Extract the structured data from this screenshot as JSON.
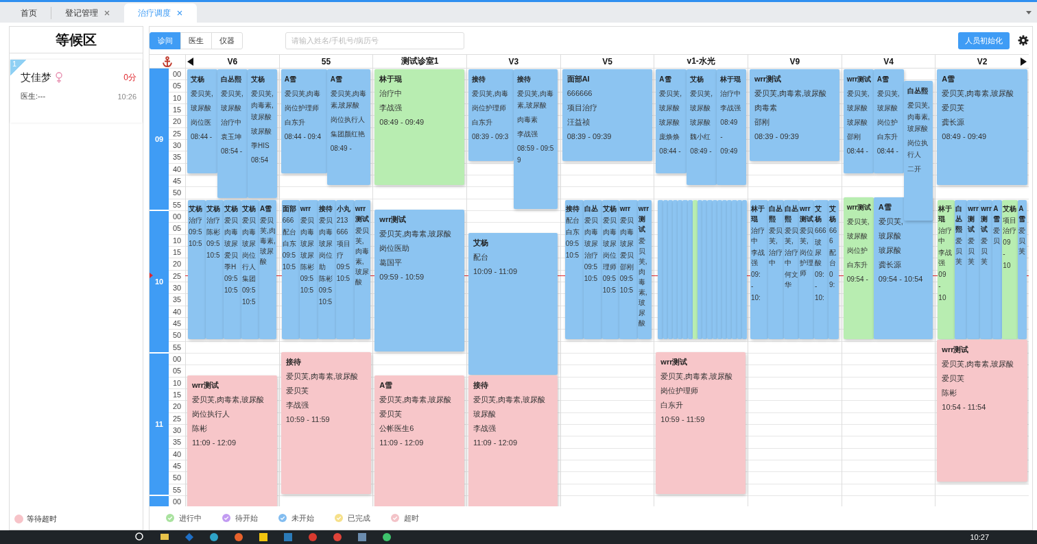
{
  "tabs": [
    {
      "label": "首页",
      "closable": false,
      "selected": false
    },
    {
      "label": "登记管理",
      "closable": true,
      "selected": false
    },
    {
      "label": "治疗调度",
      "closable": true,
      "selected": true
    }
  ],
  "waiting_area": {
    "title": "等候区",
    "patients": [
      {
        "index": "1",
        "name": "艾佳梦",
        "kind": "female",
        "score": "0分",
        "doctor": "医生:---",
        "time": "10:26"
      }
    ],
    "legend": {
      "label": "等待超时",
      "color": "#f7c3c8"
    }
  },
  "toolbar": {
    "view_tabs": [
      {
        "label": "诊间",
        "selected": true
      },
      {
        "label": "医生",
        "selected": false
      },
      {
        "label": "仪器",
        "selected": false
      }
    ],
    "search": {
      "placeholder": "请输入姓名/手机号/病历号"
    },
    "init_button": "人员初始化"
  },
  "schedule": {
    "hours": [
      {
        "label": "09",
        "minutes": [
          "00",
          "05",
          "10",
          "15",
          "20",
          "25",
          "30",
          "35",
          "40",
          "45",
          "50",
          "55"
        ]
      },
      {
        "label": "10",
        "minutes": [
          "00",
          "05",
          "10",
          "15",
          "20",
          "25",
          "30",
          "35",
          "40",
          "45",
          "50",
          "55"
        ]
      },
      {
        "label": "11",
        "minutes": [
          "00",
          "05",
          "10",
          "15",
          "20",
          "25",
          "30",
          "35",
          "40",
          "45",
          "50",
          "55"
        ]
      },
      {
        "minutes": [
          "00"
        ]
      }
    ],
    "columns": [
      {
        "name": "V6",
        "cards": [
          {
            "color": "#8cc4f1",
            "lines": [
              "艾杨",
              "爱贝芙,",
              "玻尿酸",
              "岗位医",
              "08:44 -"
            ]
          },
          {
            "color": "#8cc4f1",
            "lines": [
              "白丛熙",
              "爱贝芙,",
              "玻尿酸",
              "治疗中",
              "袁玉坤",
              "08:54 -"
            ]
          },
          {
            "color": "#8cc4f1",
            "lines": [
              "艾杨",
              "爱贝芙,肉毒素,玻尿酸",
              "玻尿酸",
              "季HIS",
              "08:54"
            ]
          },
          {
            "color": "#8cc4f1",
            "lines": [
              "艾杨",
              "治疗",
              "09:5",
              "10:5"
            ]
          },
          {
            "color": "#8cc4f1",
            "lines": [
              "艾杨",
              "治疗",
              "陈彬",
              "09:5",
              "10:5"
            ]
          },
          {
            "color": "#8cc4f1",
            "lines": [
              "艾杨",
              "爱贝",
              "肉毒",
              "玻尿",
              "爱贝",
              "季H",
              "09:5",
              "10:5"
            ]
          },
          {
            "color": "#8cc4f1",
            "lines": [
              "艾杨",
              "爱贝",
              "肉毒",
              "玻尿",
              "岗位",
              "行人",
              "集团",
              "09:5",
              "10:5"
            ]
          },
          {
            "color": "#8cc4f1",
            "lines": [
              "A雪",
              "爱贝芙,肉毒素,玻尿酸"
            ]
          },
          {
            "color": "#f7c6c9",
            "lines": [
              "wrr测试",
              "爱贝芙,肉毒素,玻尿酸",
              "岗位执行人",
              "陈彬",
              "11:09 - 12:09"
            ]
          }
        ]
      },
      {
        "name": "55",
        "cards": [
          {
            "color": "#8cc4f1",
            "lines": [
              "A雪",
              "爱贝芙,肉毒",
              "岗位护理师",
              "白东升",
              "08:44 - 09:4"
            ]
          },
          {
            "color": "#8cc4f1",
            "lines": [
              "A雪",
              "爱贝芙,肉毒素,玻尿酸",
              "岗位执行人",
              "集团颜红艳",
              "08:49 -"
            ]
          },
          {
            "color": "#8cc4f1",
            "lines": [
              "面部",
              "666",
              "配台",
              "白东",
              "09:5",
              "10:5"
            ]
          },
          {
            "color": "#8cc4f1",
            "lines": [
              "wrr",
              "爱贝",
              "肉毒",
              "玻尿",
              "玻尿",
              "陈彬",
              "09:5",
              "10:5"
            ]
          },
          {
            "color": "#8cc4f1",
            "lines": [
              "接待",
              "爱贝",
              "肉毒",
              "玻尿",
              "岗位",
              "助",
              "陈彬",
              "09:5",
              "10:5"
            ]
          },
          {
            "color": "#8cc4f1",
            "lines": [
              "小丸",
              "213",
              "666",
              "项目",
              "疗",
              "09:5",
              "10:5"
            ]
          },
          {
            "color": "#8cc4f1",
            "lines": [
              "wrr测试",
              "爱贝芙,肉毒素,玻尿酸"
            ]
          },
          {
            "color": "#f7c6c9",
            "lines": [
              "接待",
              "爱贝芙,肉毒素,玻尿酸",
              "爱贝芙",
              "李战强",
              "10:59 - 11:59"
            ]
          }
        ]
      },
      {
        "name": "测试诊室1",
        "cards": [
          {
            "color": "#b8edb1",
            "lines": [
              "林于琨",
              "治疗中",
              "李战强",
              "08:49 - 09:49"
            ]
          },
          {
            "color": "#8cc4f1",
            "lines": [
              "wrr测试",
              "爱贝芙,肉毒素,玻尿酸",
              "岗位医助",
              "葛国平",
              "09:59 - 10:59"
            ]
          },
          {
            "color": "#f7c6c9",
            "lines": [
              "A雪",
              "爱贝芙,肉毒素,玻尿酸",
              "爱贝芙",
              "公帐医生6",
              "11:09 - 12:09"
            ]
          }
        ]
      },
      {
        "name": "V3",
        "cards": [
          {
            "color": "#8cc4f1",
            "lines": [
              "接待",
              "爱贝芙,肉毒",
              "岗位护理师",
              "白东升",
              "08:39 - 09:3"
            ]
          },
          {
            "color": "#8cc4f1",
            "lines": [
              "接待",
              "爱贝芙,肉毒素,玻尿酸",
              "肉毒素",
              "李战强",
              "08:59 - 09:59"
            ]
          },
          {
            "color": "#8cc4f1",
            "lines": [
              "艾杨",
              "配台",
              "10:09 - 11:09"
            ]
          },
          {
            "color": "#f7c6c9",
            "lines": [
              "接待",
              "爱贝芙,肉毒素,玻尿酸",
              "玻尿酸",
              "李战强",
              "11:09 - 12:09"
            ]
          }
        ]
      },
      {
        "name": "V5",
        "cards": [
          {
            "color": "#8cc4f1",
            "lines": [
              "面部AI",
              "666666",
              "项目治疗",
              "汪益祯",
              "08:39 - 09:39"
            ]
          },
          {
            "color": "#8cc4f1",
            "lines": [
              "接待",
              "配台",
              "白东",
              "09:5",
              "10:5"
            ]
          },
          {
            "color": "#8cc4f1",
            "lines": [
              "白丛",
              "爱贝",
              "肉毒",
              "玻尿",
              "治疗",
              "09:5",
              "10:5"
            ]
          },
          {
            "color": "#8cc4f1",
            "lines": [
              "艾杨",
              "爱贝",
              "肉毒",
              "玻尿",
              "岗位",
              "理师",
              "09:5",
              "10:5"
            ]
          },
          {
            "color": "#8cc4f1",
            "lines": [
              "wrr",
              "爱贝",
              "肉毒",
              "玻尿",
              "爱贝",
              "邵刚",
              "09:5",
              "10:5"
            ]
          },
          {
            "color": "#8cc4f1",
            "lines": [
              "wrr测试",
              "爱贝芙,肉毒素,玻尿酸"
            ]
          }
        ]
      },
      {
        "name": "v1-水光",
        "cards": [
          {
            "color": "#8cc4f1",
            "lines": [
              "A雪",
              "爱贝芙,",
              "玻尿酸",
              "玻尿酸",
              "庞焕焕",
              "08:44 -"
            ]
          },
          {
            "color": "#8cc4f1",
            "lines": [
              "艾杨",
              "爱贝芙,",
              "玻尿酸",
              "玻尿酸",
              "魏小红",
              "08:49 -"
            ]
          },
          {
            "color": "#8cc4f1",
            "lines": [
              "林于琨",
              "治疗中",
              "李战强",
              "08:49",
              "-",
              "09:49"
            ]
          },
          {
            "color": "#8cc4f1"
          },
          {
            "color": "#8cc4f1"
          },
          {
            "color": "#8cc4f1"
          },
          {
            "color": "#8cc4f1"
          },
          {
            "color": "#8cc4f1"
          },
          {
            "color": "#8cc4f1"
          },
          {
            "color": "#8cc4f1"
          },
          {
            "color": "#b8edb1"
          },
          {
            "color": "#8cc4f1"
          },
          {
            "color": "#8cc4f1"
          },
          {
            "color": "#8cc4f1"
          },
          {
            "color": "#8cc4f1"
          },
          {
            "color": "#8cc4f1"
          },
          {
            "color": "#8cc4f1"
          },
          {
            "color": "#8cc4f1"
          },
          {
            "color": "#8cc4f1"
          },
          {
            "color": "#8cc4f1"
          },
          {
            "color": "#8cc4f1"
          },
          {
            "color": "#f7c6c9",
            "lines": [
              "wrr测试",
              "爱贝芙,肉毒素,玻尿酸",
              "岗位护理师",
              "白东升",
              "10:59 - 11:59"
            ]
          }
        ]
      },
      {
        "name": "V9",
        "cards": [
          {
            "color": "#8cc4f1",
            "lines": [
              "wrr测试",
              "爱贝芙,肉毒素,玻尿酸",
              "肉毒素",
              "邵刚",
              "08:39 - 09:39"
            ]
          },
          {
            "color": "#8cc4f1",
            "lines": [
              "林于琨",
              "治疗中",
              "李战强",
              "09:",
              "-",
              "10:"
            ]
          },
          {
            "color": "#8cc4f1",
            "lines": [
              "白丛熙",
              "爱贝芙,",
              "治疗中"
            ]
          },
          {
            "color": "#8cc4f1",
            "lines": [
              "白丛熙",
              "爱贝芙,",
              "治疗中",
              "何文华"
            ]
          },
          {
            "color": "#8cc4f1",
            "lines": [
              "wrr测试",
              "爱贝芙,",
              "岗位护理师"
            ]
          },
          {
            "color": "#8cc4f1",
            "lines": [
              "艾杨",
              "666",
              "玻尿酸",
              "09:",
              "-",
              "10:"
            ]
          },
          {
            "color": "#8cc4f1",
            "lines": [
              "艾杨",
              "666",
              "配台",
              "09:"
            ]
          }
        ]
      },
      {
        "name": "V4",
        "cards": [
          {
            "color": "#8cc4f1",
            "lines": [
              "wrr测试",
              "爱贝芙,",
              "玻尿酸",
              "玻尿酸",
              "邵刚",
              "08:44 -"
            ]
          },
          {
            "color": "#8cc4f1",
            "lines": [
              "A雪",
              "爱贝芙,",
              "玻尿酸",
              "岗位护",
              "白东升",
              "08:44 -"
            ]
          },
          {
            "color": "#b8edb1",
            "lines": [
              "wrr测试",
              "爱贝芙,",
              "玻尿酸",
              "岗位护",
              "白东升",
              "09:54 -"
            ]
          },
          {
            "color": "#8cc4f1",
            "lines": [
              "A雪",
              "爱贝芙,",
              "玻尿酸",
              "玻尿酸",
              "龚长源",
              "09:54 - 10:54"
            ]
          },
          {
            "color": "#8cc4f1",
            "lines": [
              "白丛熙",
              "爱贝芙,肉毒素,玻尿酸",
              "岗位执行人",
              "二开"
            ]
          }
        ]
      },
      {
        "name": "V2",
        "cards": [
          {
            "color": "#8cc4f1",
            "lines": [
              "A雪",
              "爱贝芙,肉毒素,玻尿酸",
              "爱贝芙",
              "龚长源",
              "08:49 - 09:49"
            ]
          },
          {
            "color": "#b8edb1",
            "lines": [
              "林于琨",
              "治疗中",
              "李战强",
              "09",
              "-",
              "10"
            ]
          },
          {
            "color": "#8cc4f1",
            "lines": [
              "白丛熙",
              "爱贝芙"
            ]
          },
          {
            "color": "#8cc4f1",
            "lines": [
              "wrr测试",
              "爱贝芙"
            ]
          },
          {
            "color": "#8cc4f1",
            "lines": [
              "wrr测试",
              "爱贝芙"
            ]
          },
          {
            "color": "#8cc4f1",
            "lines": [
              "A雪",
              "爱贝"
            ]
          },
          {
            "color": "#b8edb1",
            "lines": [
              "艾杨",
              "项目治疗",
              "09",
              "-",
              "10"
            ]
          },
          {
            "color": "#8cc4f1",
            "lines": [
              "A雪",
              "爱贝芙"
            ]
          },
          {
            "color": "#f7c6c9",
            "lines": [
              "wrr测试",
              "爱贝芙,肉毒素,玻尿酸",
              "爱贝芙",
              "陈彬",
              "10:54 - 11:54"
            ]
          }
        ]
      }
    ]
  },
  "legend": [
    {
      "label": "进行中",
      "color": "#a9e29f"
    },
    {
      "label": "待开始",
      "color": "#c29bf2"
    },
    {
      "label": "未开始",
      "color": "#83bdf0"
    },
    {
      "label": "已完成",
      "color": "#f6e08a"
    },
    {
      "label": "超时",
      "color": "#f3c3c8"
    }
  ],
  "taskbar": {
    "clock": "10:27"
  }
}
